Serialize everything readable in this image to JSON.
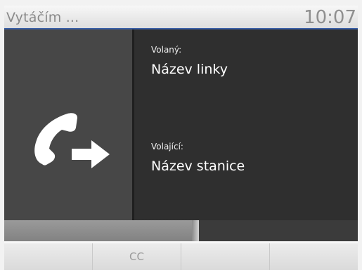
{
  "header": {
    "title": "Vytáčím ...",
    "time": "10:07",
    "accent_color": "#3a5fa6"
  },
  "call": {
    "icon": "outgoing-call-handset-arrow-icon",
    "called_label": "Volaný:",
    "called_value": "Název linky",
    "caller_label": "Volající:",
    "caller_value": "Název stanice"
  },
  "progress": {
    "fraction": 0.55
  },
  "softkeys": [
    "",
    "CC",
    "",
    ""
  ]
}
